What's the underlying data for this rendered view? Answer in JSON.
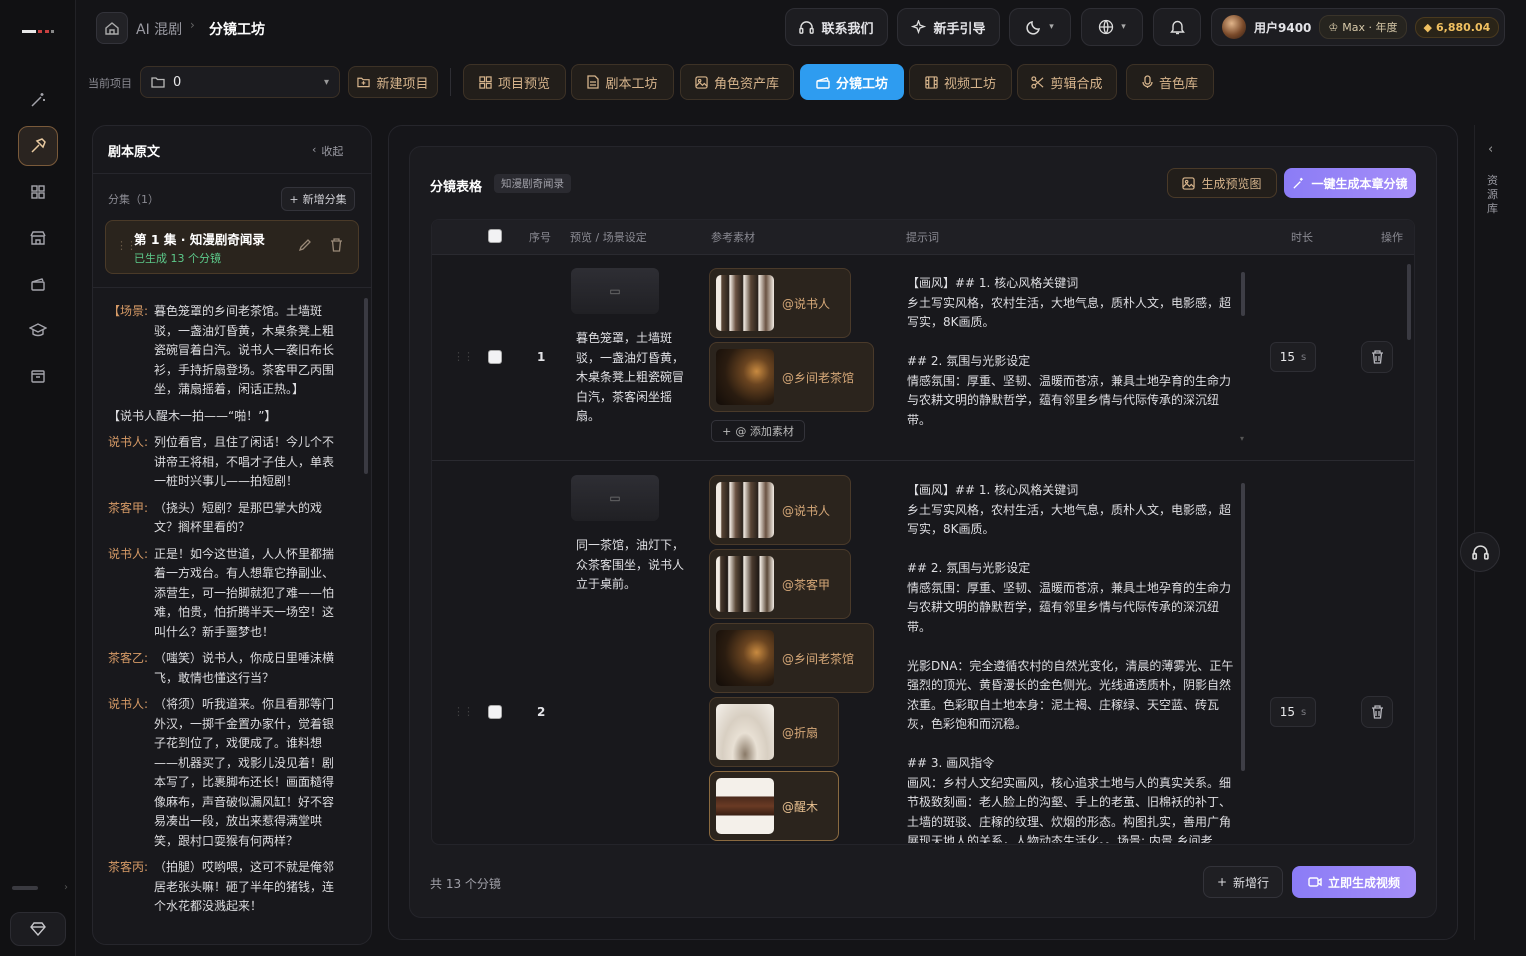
{
  "nav": {
    "home_crumb": "AI 混剧",
    "current_crumb": "分镜工坊",
    "contact": "联系我们",
    "guide": "新手引导",
    "username": "用户9400",
    "plan": "Max · 年度",
    "credits": "6,880.04"
  },
  "toolbar": {
    "project_label": "当前项目",
    "project_value": "0",
    "new_project": "新建项目",
    "tabs": [
      {
        "label": "项目预览",
        "icon": "grid-icon"
      },
      {
        "label": "剧本工坊",
        "icon": "doc-icon"
      },
      {
        "label": "角色资产库",
        "icon": "image-icon"
      },
      {
        "label": "分镜工坊",
        "icon": "clapper-icon",
        "active": true
      },
      {
        "label": "视频工坊",
        "icon": "film-icon"
      },
      {
        "label": "剪辑合成",
        "icon": "scissors-icon"
      },
      {
        "label": "音色库",
        "icon": "mic-icon"
      }
    ]
  },
  "script_panel": {
    "title": "剧本原文",
    "collapse": "收起",
    "episodes_label": "分集（1）",
    "add_episode": "新增分集",
    "episode_title": "第 1 集 · 知漫剧奇闻录",
    "episode_status": "已生成 13 个分镜",
    "lines": [
      {
        "speaker": "【场景:",
        "text": "暮色笼罩的乡间老茶馆。土墙斑驳，一盏油灯昏黄，木桌条凳上粗瓷碗冒着白汽。说书人一袭旧布长衫，手持折扇登场。茶客甲乙丙围坐，蒲扇摇着，闲话正热。】"
      },
      {
        "speaker": "",
        "text": "【说书人醒木一拍——“啪！”】"
      },
      {
        "speaker": "说书人:",
        "text": "列位看官，且住了闲话！今儿个不讲帝王将相，不唱才子佳人，单表一桩时兴事儿——拍短剧！"
      },
      {
        "speaker": "茶客甲:",
        "text": "（挠头）短剧？是那巴掌大的戏文？搁杯里看的？"
      },
      {
        "speaker": "说书人:",
        "text": "正是！如今这世道，人人怀里都揣着一方戏台。有人想靠它挣副业、添营生，可一抬脚就犯了难——怕难，怕贵，怕折腾半天一场空！这叫什么？新手噩梦也！"
      },
      {
        "speaker": "茶客乙:",
        "text": "（嗤笑）说书人，你成日里唾沫横飞，敢情也懂这行当？"
      },
      {
        "speaker": "说书人:",
        "text": "（将须）听我道来。你且看那等门外汉，一掷千金置办家什，觉着银子花到位了，戏便成了。谁料想——机器买了，戏影儿没见着！剧本写了，比裹脚布还长！画面糙得像麻布，声音破似漏风缸！好不容易凑出一段，放出来惹得满堂哄笑，跟村口耍猴有何两样？"
      },
      {
        "speaker": "茶客丙:",
        "text": "（拍腿）哎哟喂，这可不就是俺邻居老张头嘛！砸了半年的猪钱，连个水花都没溅起来！"
      }
    ]
  },
  "table": {
    "title": "分镜表格",
    "tag": "知漫剧奇闻录",
    "gen_preview": "生成预览图",
    "gen_all": "一键生成本章分镜",
    "headers": {
      "index": "序号",
      "preview": "预览 / 场景设定",
      "refs": "参考素材",
      "prompt": "提示词",
      "duration": "时长",
      "ops": "操作"
    },
    "add_ref": "@ 添加素材",
    "rows": [
      {
        "index": "1",
        "scene": "暮色笼罩，土墙斑驳，一盏油灯昏黄，木桌条凳上粗瓷碗冒白汽，茶客闲坐摇扇。",
        "refs": [
          "@说书人",
          "@乡间老茶馆"
        ],
        "prompt": "【画风】## 1. 核心风格关键词\n乡土写实风格，农村生活，大地气息，质朴人文，电影感，超写实，8K画质。\n\n## 2. 氛围与光影设定\n情感氛围：厚重、坚韧、温暖而苍凉，兼具土地孕育的生命力与农耕文明的静默哲学，蕴有邻里乡情与代际传承的深沉纽带。",
        "duration": "15",
        "unit": "s"
      },
      {
        "index": "2",
        "scene": "同一茶馆，油灯下，众茶客围坐，说书人立于桌前。",
        "refs": [
          "@说书人",
          "@茶客甲",
          "@乡间老茶馆",
          "@折扇",
          "@醒木"
        ],
        "prompt": "【画风】## 1. 核心风格关键词\n乡土写实风格，农村生活，大地气息，质朴人文，电影感，超写实，8K画质。\n\n## 2. 氛围与光影设定\n情感氛围：厚重、坚韧、温暖而苍凉，兼具土地孕育的生命力与农耕文明的静默哲学，蕴有邻里乡情与代际传承的深沉纽带。\n\n光影DNA：完全遵循农村的自然光变化，清晨的薄雾光、正午强烈的顶光、黄昏漫长的金色侧光。光线通透质朴，阴影自然浓重。色彩取自土地本身：泥土褐、庄稼绿、天空蓝、砖瓦灰，色彩饱和而沉稳。\n\n## 3. 画风指令\n画风：乡村人文纪实画风，核心追求土地与人的真实关系。细节极致刻画：老人脸上的沟壑、手上的老茧、旧棉袄的补丁、土墙的斑驳、庄稼的纹理、炊烟的形态。构图扎实，善用广角展现天地人的关系，人物动态生活化。。场景: 内景 乡间老",
        "duration": "15",
        "unit": "s"
      }
    ],
    "footer_count": "共 13 个分镜",
    "add_row": "新增行",
    "gen_video": "立即生成视频"
  },
  "right_rail": {
    "label": "资源库"
  },
  "colors": {
    "accent_blue": "#2e9cf0",
    "bronze": "#d6b48c",
    "purple": "#8b7cf6"
  }
}
